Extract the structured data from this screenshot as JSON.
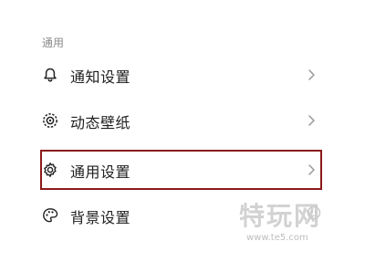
{
  "section": {
    "header": "通用"
  },
  "items": [
    {
      "label": "通知设置",
      "icon": "bell-icon"
    },
    {
      "label": "动态壁纸",
      "icon": "dynamic-wallpaper-icon"
    },
    {
      "label": "通用设置",
      "icon": "gear-icon"
    },
    {
      "label": "背景设置",
      "icon": "palette-icon"
    }
  ],
  "watermark": {
    "logo": "特玩网",
    "url": "www.te5.com"
  },
  "colors": {
    "highlight": "#8b1a1a",
    "text": "#1f1f1f",
    "muted": "#8a8a8a"
  }
}
